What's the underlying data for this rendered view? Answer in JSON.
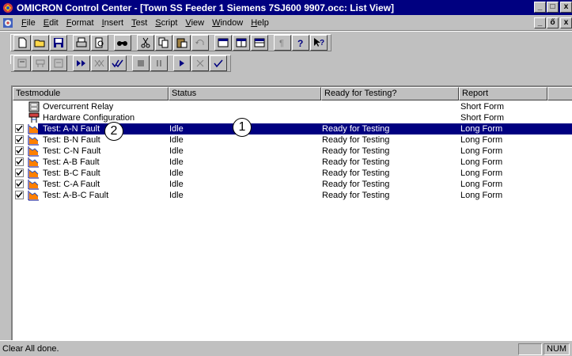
{
  "window": {
    "title": "OMICRON Control Center - [Town SS Feeder 1 Siemens 7SJ600 9907.occ: List View]",
    "controls": [
      "_",
      "□",
      "x"
    ]
  },
  "menubar": {
    "items": [
      {
        "accel": "F",
        "rest": "ile"
      },
      {
        "accel": "E",
        "rest": "dit"
      },
      {
        "accel": "F",
        "rest": "ormat",
        "pre": ""
      },
      {
        "accel": "I",
        "rest": "nsert"
      },
      {
        "accel": "T",
        "rest": "est"
      },
      {
        "accel": "S",
        "rest": "cript"
      },
      {
        "accel": "V",
        "rest": "iew"
      },
      {
        "accel": "W",
        "rest": "indow"
      },
      {
        "accel": "H",
        "rest": "elp"
      }
    ],
    "mdi_controls": [
      "_",
      "ő",
      "x"
    ]
  },
  "toolbar1": [
    "new-icon",
    "open-icon",
    "save-icon",
    "print-icon",
    "print-preview-icon",
    "find-icon",
    "cut-icon",
    "copy-icon",
    "paste-icon",
    "undo-icon",
    "view-list-icon",
    "view-split-icon",
    "view-detail-icon",
    "paragraph-icon",
    "help-icon",
    "context-help-icon"
  ],
  "toolbar2": [
    "module-icon",
    "hardware-icon",
    "relay-icon",
    "start-all-icon",
    "clear-all-icon",
    "check-all-icon",
    "stop-icon",
    "pause-icon",
    "run-icon",
    "clear-icon",
    "check-icon"
  ],
  "listview": {
    "columns": [
      "Testmodule",
      "Status",
      "Ready for Testing?",
      "Report",
      ""
    ],
    "rows": [
      {
        "checked": null,
        "icon": "relay-icon",
        "name": "Overcurrent Relay",
        "status": "",
        "ready": "",
        "report": "Short Form",
        "selected": false
      },
      {
        "checked": null,
        "icon": "hardware-icon",
        "name": "Hardware Configuration",
        "status": "",
        "ready": "",
        "report": "Short Form",
        "selected": false
      },
      {
        "checked": true,
        "icon": "test-module-icon",
        "name": "Test: A-N Fault",
        "status": "Idle",
        "ready": "Ready for Testing",
        "report": "Long Form",
        "selected": true
      },
      {
        "checked": true,
        "icon": "test-module-icon",
        "name": "Test: B-N Fault",
        "status": "Idle",
        "ready": "Ready for Testing",
        "report": "Long Form",
        "selected": false
      },
      {
        "checked": true,
        "icon": "test-module-icon",
        "name": "Test: C-N Fault",
        "status": "Idle",
        "ready": "Ready for Testing",
        "report": "Long Form",
        "selected": false
      },
      {
        "checked": true,
        "icon": "test-module-icon",
        "name": "Test: A-B Fault",
        "status": "Idle",
        "ready": "Ready for Testing",
        "report": "Long Form",
        "selected": false
      },
      {
        "checked": true,
        "icon": "test-module-icon",
        "name": "Test: B-C Fault",
        "status": "Idle",
        "ready": "Ready for Testing",
        "report": "Long Form",
        "selected": false
      },
      {
        "checked": true,
        "icon": "test-module-icon",
        "name": "Test: C-A Fault",
        "status": "Idle",
        "ready": "Ready for Testing",
        "report": "Long Form",
        "selected": false
      },
      {
        "checked": true,
        "icon": "test-module-icon",
        "name": "Test: A-B-C Fault",
        "status": "Idle",
        "ready": "Ready for Testing",
        "report": "Long Form",
        "selected": false
      }
    ]
  },
  "callouts": [
    "1",
    "2"
  ],
  "statusbar": {
    "message": "Clear All done.",
    "indicator": "NUM"
  },
  "colors": {
    "titlebar": "#000080",
    "selection": "#000080",
    "chrome": "#c0c0c0"
  }
}
